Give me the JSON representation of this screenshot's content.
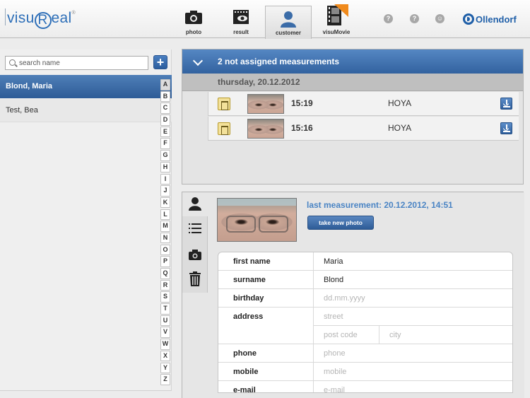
{
  "app": {
    "logo_text": "visuReal",
    "brand": "Ollendorf"
  },
  "nav": {
    "tabs": [
      {
        "label": "photo"
      },
      {
        "label": "result"
      },
      {
        "label": "customer"
      },
      {
        "label": "visuMovie"
      }
    ],
    "active": "customer",
    "help_icons": [
      "?",
      "?",
      "☺"
    ]
  },
  "search": {
    "placeholder": "search name",
    "value": ""
  },
  "customers": [
    {
      "name": "Blond, Maria",
      "selected": true
    },
    {
      "name": "Test, Bea",
      "selected": false
    }
  ],
  "alphabet": [
    "A",
    "B",
    "C",
    "D",
    "E",
    "F",
    "G",
    "H",
    "I",
    "J",
    "K",
    "L",
    "M",
    "N",
    "O",
    "P",
    "Q",
    "R",
    "S",
    "T",
    "U",
    "V",
    "W",
    "X",
    "Y",
    "Z"
  ],
  "measurements": {
    "header": "2 not assigned measurements",
    "date": "thursday, 20.12.2012",
    "rows": [
      {
        "time": "15:19",
        "brand": "HOYA"
      },
      {
        "time": "15:16",
        "brand": "HOYA"
      }
    ]
  },
  "detail": {
    "last_measurement": "last measurement: 20.12.2012, 14:51",
    "take_photo_label": "take new photo",
    "fields": {
      "first_name": {
        "label": "first name",
        "value": "Maria"
      },
      "surname": {
        "label": "surname",
        "value": "Blond"
      },
      "birthday": {
        "label": "birthday",
        "placeholder": "dd.mm.yyyy"
      },
      "address": {
        "label": "address",
        "street_placeholder": "street",
        "postcode_placeholder": "post code",
        "city_placeholder": "city"
      },
      "phone": {
        "label": "phone",
        "placeholder": "phone"
      },
      "mobile": {
        "label": "mobile",
        "placeholder": "mobile"
      },
      "email": {
        "label": "e-mail",
        "placeholder": "e-mail"
      }
    }
  },
  "colors": {
    "accent": "#2d5b97",
    "link": "#4a84c4",
    "trash": "#f3e19a"
  }
}
